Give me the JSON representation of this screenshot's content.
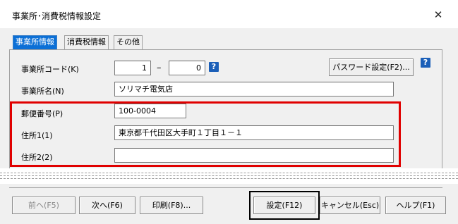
{
  "window": {
    "title": "事業所･消費税情報設定",
    "close_glyph": "✕"
  },
  "tabs": [
    {
      "label": "事業所情報",
      "active": true
    },
    {
      "label": "消費税情報",
      "active": false
    },
    {
      "label": "その他",
      "active": false
    }
  ],
  "form": {
    "office_code_label": "事業所コード(K)",
    "office_code_1": "1",
    "dash": "–",
    "office_code_2": "0",
    "help_glyph": "?",
    "password_button": "パスワード設定(F2)...",
    "office_name_label": "事業所名(N)",
    "office_name": "ソリマチ電気店",
    "postal_label": "郵便番号(P)",
    "postal": "100-0004",
    "address1_label": "住所1(1)",
    "address1": "東京都千代田区大手町１丁目１－１",
    "address2_label": "住所2(2)",
    "address2": ""
  },
  "footer": {
    "prev_button": "前へ(F5)",
    "next_button": "次へ(F6)",
    "print_button": "印刷(F8)...",
    "settings_button": "設定(F12)",
    "cancel_button": "キャンセル(Esc)",
    "help_button": "ヘルプ(F1)"
  },
  "colors": {
    "active_tab": "#0b6fd6",
    "highlight_red": "#e00000",
    "help_icon": "#1b5fb8"
  }
}
